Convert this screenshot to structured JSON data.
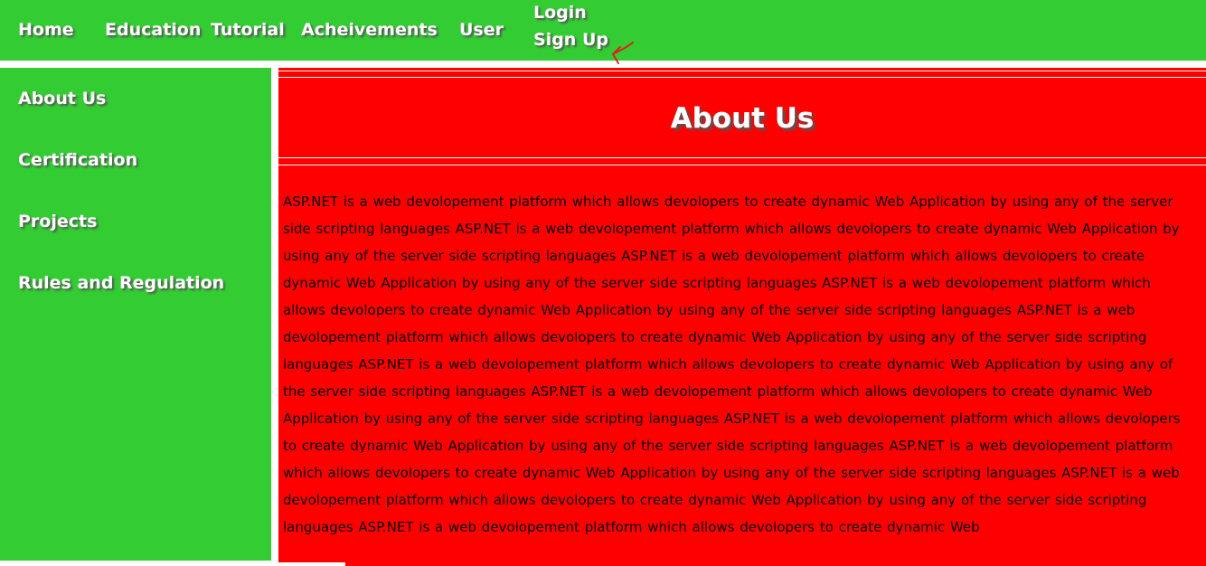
{
  "topnav": {
    "home": "Home",
    "education": "Education",
    "tutorial": "Tutorial",
    "achievements": "Acheivements",
    "user": "User",
    "login": "Login",
    "signup": "Sign Up"
  },
  "sidebar": {
    "items": [
      {
        "label": "About Us"
      },
      {
        "label": "Certification"
      },
      {
        "label": "Projects"
      },
      {
        "label": "Rules and Regulation"
      }
    ]
  },
  "main": {
    "title": "About Us",
    "body": "ASP.NET is a web devolopement platform which allows devolopers to create dynamic Web Application by using any of the server side scripting languages ASP.NET is a web devolopement platform which allows devolopers to create dynamic Web Application by using any of the server side scripting languages ASP.NET is a web devolopement platform which allows devolopers to create dynamic Web Application by using any of the server side scripting languages ASP.NET is a web devolopement platform which allows devolopers to create dynamic Web Application by using any of the server side scripting languages ASP.NET is a web devolopement platform which allows devolopers to create dynamic Web Application by using any of the server side scripting languages ASP.NET is a web devolopement platform which allows devolopers to create dynamic Web Application by using any of the server side scripting languages ASP.NET is a web devolopement platform which allows devolopers to create dynamic Web Application by using any of the server side scripting languages ASP.NET is a web devolopement platform which allows devolopers to create dynamic Web Application by using any of the server side scripting languages ASP.NET is a web devolopement platform which allows devolopers to create dynamic Web Application by using any of the server side scripting languages ASP.NET is a web devolopement platform which allows devolopers to create dynamic Web Application by using any of the server side scripting languages ASP.NET is a web devolopement platform which allows devolopers to create dynamic Web"
  },
  "colors": {
    "nav_green": "#33cc33",
    "content_red": "#ff0000",
    "annotation_red": "#e02020"
  }
}
